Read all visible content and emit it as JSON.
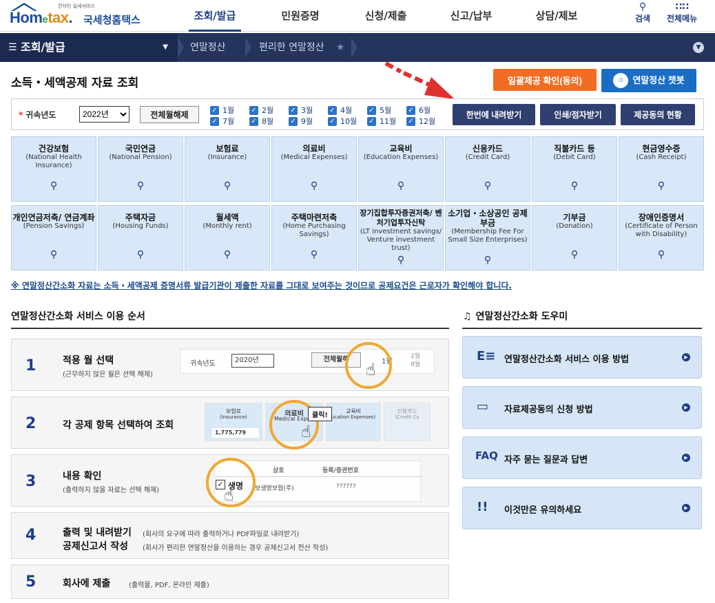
{
  "header": {
    "logo_sub": "전자민 실세서비스",
    "logo_brand_a": "Hom",
    "logo_brand_b": "e",
    "logo_brand_c": "tax",
    "logo_kr": "국세청홈택스",
    "menu": [
      "조회/발급",
      "민원증명",
      "신청/제출",
      "신고/납부",
      "상담/제보"
    ],
    "search_label": "검색",
    "all_menu_label": "전체메뉴"
  },
  "navbar": {
    "menu_label": "조회/발급",
    "crumb1": "연말정산",
    "crumb2": "편리한 연말정산"
  },
  "page": {
    "title": "소득・세액공제 자료 조회",
    "btn_batch_consent": "일괄제공 확인(동의)",
    "btn_chatbot": "연말정산 챗봇"
  },
  "filter": {
    "year_label": "귀속년도",
    "year_value": "2022년",
    "deselect_all": "전체월해제",
    "months": [
      "1월",
      "2월",
      "3월",
      "4월",
      "5월",
      "6월",
      "7월",
      "8월",
      "9월",
      "10월",
      "11월",
      "12월"
    ],
    "btn_download_all": "한번에 내려받기",
    "btn_print": "인쇄/점자받기",
    "btn_consent_status": "제공동의 현황"
  },
  "categories": [
    {
      "kr": "건강보험",
      "en": "(National Health Insurance)"
    },
    {
      "kr": "국민연금",
      "en": "(National Pension)"
    },
    {
      "kr": "보험료",
      "en": "(Insurance)"
    },
    {
      "kr": "의료비",
      "en": "(Medical Expenses)"
    },
    {
      "kr": "교육비",
      "en": "(Education Expenses)"
    },
    {
      "kr": "신용카드",
      "en": "(Credit Card)"
    },
    {
      "kr": "직불카드 등",
      "en": "(Debit Card)"
    },
    {
      "kr": "현금영수증",
      "en": "(Cash Receipt)"
    },
    {
      "kr": "개인연금저축/ 연금계좌",
      "en": "(Pension Savings)"
    },
    {
      "kr": "주택자금",
      "en": "(Housing Funds)"
    },
    {
      "kr": "월세액",
      "en": "(Monthly rent)"
    },
    {
      "kr": "주택마련저축",
      "en": "(Home Purchasing Savings)"
    },
    {
      "kr": "장기집합투자증권저축/ 벤처기업투자신탁",
      "en": "(LT investment savings/ Venture investment trust)"
    },
    {
      "kr": "소기업・소상공인 공제부금",
      "en": "(Membership Fee For Small Size Enterprises)"
    },
    {
      "kr": "기부금",
      "en": "(Donation)"
    },
    {
      "kr": "장애인증명서",
      "en": "(Certificate of Person with Disability)"
    }
  ],
  "notice": "※ 연말정산간소화 자료는 소득・세액공제 증명서류 발급기관이 제출한 자료를 그대로 보여주는 것이므로 공제요건은 근로자가 확인해야 합니다.",
  "steps_section": {
    "title": "연말정산간소화 서비스 이용 순서",
    "steps": [
      {
        "num": "1",
        "title": "적용 월 선택",
        "desc": "(근무하지 않은 월은 선택 해제)"
      },
      {
        "num": "2",
        "title": "각 공제 항목 선택하여 조회",
        "desc": ""
      },
      {
        "num": "3",
        "title": "내용 확인",
        "desc": "(출력하지 않을 자료는 선택 해제)"
      },
      {
        "num": "4",
        "title": "출력 및 내려받기",
        "desc": "(회사의 요구에 따라 출력하거나 PDF파일로 내려받기)",
        "title2": "공제신고서 작성",
        "desc2": "(회사가 편리한 연말정산을 이용하는 경우 공제신고서 전산 작성)"
      },
      {
        "num": "5",
        "title": "회사에 제출",
        "desc": "(출력물, PDF, 온라인 제출)"
      }
    ]
  },
  "illus": {
    "s1_year_label": "귀속년도",
    "s1_year_value": "2020년",
    "s1_deselect": "전체월해",
    "s1_m1": "1월",
    "s1_m2": "2월",
    "s1_m8": "8월",
    "s2_insurance": "보험료",
    "s2_insurance_en": "(Insurance)",
    "s2_insurance_amount": "1,775,779",
    "s2_medical": "의료비",
    "s2_medical_en": "Medical Expen",
    "s2_click": "클릭!",
    "s2_education": "교육비",
    "s2_education_en": "ucation Expenses)",
    "s2_credit": "신용카드",
    "s2_credit_en": "(Credit Ca",
    "s3_col_name": "상호",
    "s3_col_bizno": "등록/증권번호",
    "s3_row_name": "생명",
    "s3_row_full": "보생명보험(주)",
    "s3_row_no": "??????"
  },
  "helper_section": {
    "title": "연말정산간소화 도우미",
    "items": [
      {
        "icon": "E≡",
        "label": "연말정산간소화 서비스 이용 방법"
      },
      {
        "icon": "▭",
        "label": "자료제공동의 신청 방법"
      },
      {
        "icon": "FAQ",
        "label": "자주 묻는 질문과 답변"
      },
      {
        "icon": "!!",
        "label": "이것만은 유의하세요"
      }
    ]
  },
  "colors": {
    "navy": "#25345c",
    "orange": "#f26d24",
    "blue": "#1a6dc4",
    "tile": "#d8e8f8",
    "highlight_ring": "#f0a830",
    "annotation_arrow": "#e03030"
  }
}
